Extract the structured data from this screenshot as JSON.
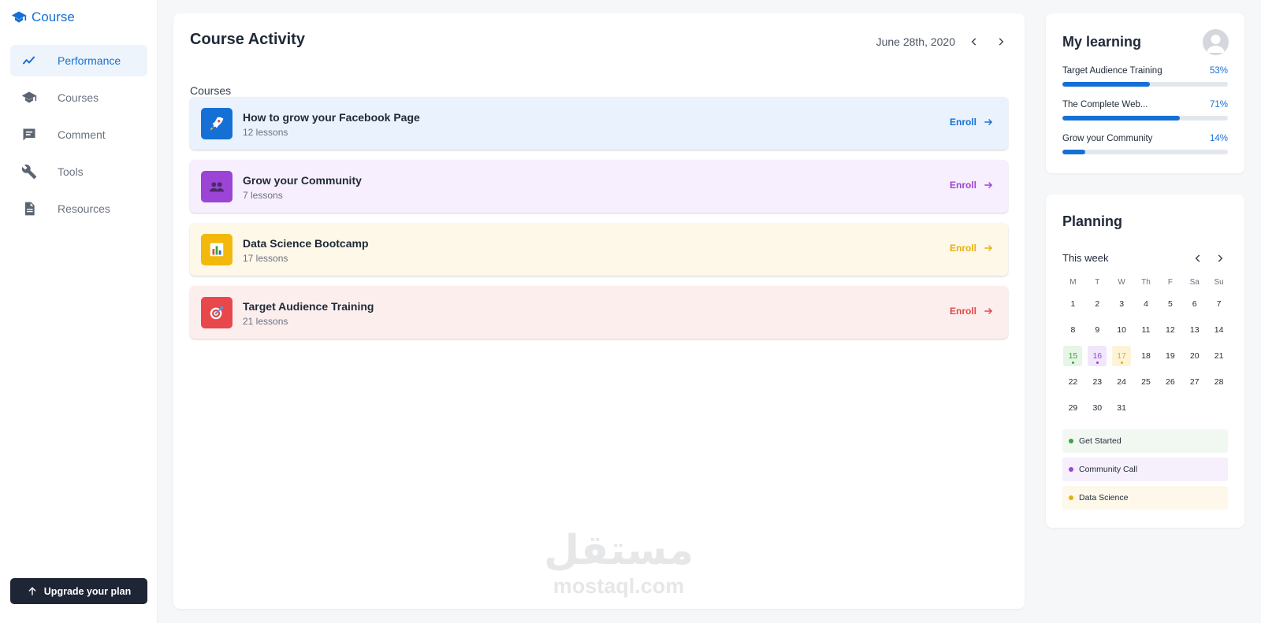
{
  "app": {
    "name": "Course",
    "brand_color": "#1570d6"
  },
  "sidebar": {
    "items": [
      {
        "label": "Performance",
        "icon": "trend-line-icon",
        "active": true
      },
      {
        "label": "Courses",
        "icon": "graduation-cap-icon",
        "active": false
      },
      {
        "label": "Comment",
        "icon": "comment-icon",
        "active": false
      },
      {
        "label": "Tools",
        "icon": "wrench-icon",
        "active": false
      },
      {
        "label": "Resources",
        "icon": "document-icon",
        "active": false
      }
    ],
    "upgrade_label": "Upgrade your plan"
  },
  "main": {
    "title": "Course Activity",
    "date": "June 28th, 2020",
    "section_label": "Courses",
    "courses": [
      {
        "title": "How to grow your Facebook Page",
        "lessons": "12 lessons",
        "enroll": "Enroll",
        "icon": "rocket-icon",
        "bg": "#eaf2fd",
        "accent": "#1570d6"
      },
      {
        "title": "Grow your Community",
        "lessons": "7 lessons",
        "enroll": "Enroll",
        "icon": "people-icon",
        "bg": "#f7effd",
        "accent": "#9b44d6"
      },
      {
        "title": "Data Science Bootcamp",
        "lessons": "17 lessons",
        "enroll": "Enroll",
        "icon": "bar-chart-icon",
        "bg": "#fdf8e8",
        "accent": "#e8b00e"
      },
      {
        "title": "Target Audience Training",
        "lessons": "21 lessons",
        "enroll": "Enroll",
        "icon": "target-icon",
        "bg": "#fdeeee",
        "accent": "#e04848"
      }
    ]
  },
  "my_learning": {
    "title": "My learning",
    "items": [
      {
        "label": "Target Audience Training",
        "value": "53%",
        "progress": 0.53
      },
      {
        "label": "The Complete Web...",
        "value": "71%",
        "progress": 0.71
      },
      {
        "label": "Grow your Community",
        "value": "14%",
        "progress": 0.14
      }
    ]
  },
  "planning": {
    "title": "Planning",
    "week_label": "This week",
    "weekdays": [
      "M",
      "T",
      "W",
      "Th",
      "F",
      "Sa",
      "Su"
    ],
    "weeks": [
      [
        "1",
        "2",
        "3",
        "4",
        "5",
        "6",
        "7"
      ],
      [
        "8",
        "9",
        "10",
        "11",
        "12",
        "13",
        "14"
      ],
      [
        "15",
        "16",
        "17",
        "18",
        "19",
        "20",
        "21"
      ],
      [
        "22",
        "23",
        "24",
        "25",
        "26",
        "27",
        "28"
      ],
      [
        "29",
        "30",
        "31",
        "",
        "",
        "",
        ""
      ]
    ],
    "highlights": {
      "15": {
        "bg": "#e6f5e6",
        "color": "#3aa53a"
      },
      "16": {
        "bg": "#f1e6fb",
        "color": "#9b44d6"
      },
      "17": {
        "bg": "#fdf3d6",
        "color": "#e8b00e"
      }
    },
    "events": [
      {
        "label": "Get Started",
        "dot": "#3aa53a",
        "bg": "#f1f8f1"
      },
      {
        "label": "Community Call",
        "dot": "#9b44d6",
        "bg": "#f6effc"
      },
      {
        "label": "Data Science",
        "dot": "#e8b00e",
        "bg": "#fdf8ea"
      }
    ]
  },
  "watermark": {
    "arabic": "مستقل",
    "latin": "mostaql.com"
  }
}
